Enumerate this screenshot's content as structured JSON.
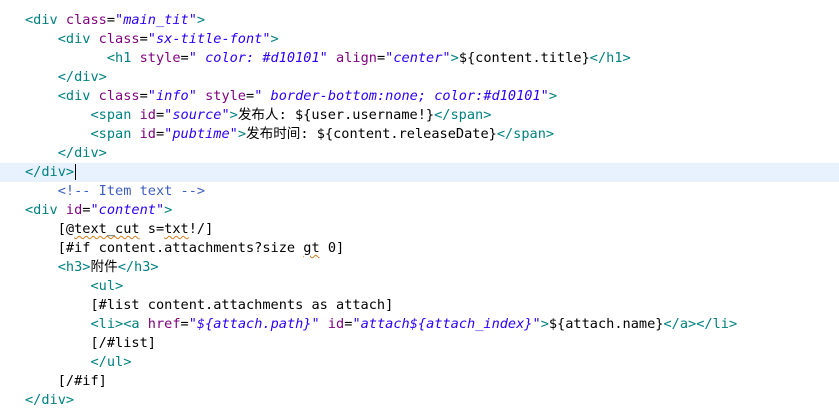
{
  "editor": {
    "lines": [
      [
        {
          "t": "<div ",
          "c": "tg"
        },
        {
          "t": "class",
          "c": "an"
        },
        {
          "t": "=",
          "c": "tx"
        },
        {
          "t": "\"main_tit\"",
          "c": "av"
        },
        {
          "t": ">",
          "c": "tg"
        }
      ],
      [
        {
          "t": "    "
        },
        {
          "t": "<div ",
          "c": "tg"
        },
        {
          "t": "class",
          "c": "an"
        },
        {
          "t": "=",
          "c": "tx"
        },
        {
          "t": "\"sx-title-font\"",
          "c": "av"
        },
        {
          "t": ">",
          "c": "tg"
        }
      ],
      [
        {
          "t": "          "
        },
        {
          "t": "<h1 ",
          "c": "tg"
        },
        {
          "t": "style",
          "c": "an"
        },
        {
          "t": "=",
          "c": "tx"
        },
        {
          "t": "\" color: #d10101\"",
          "c": "av"
        },
        {
          "t": " align",
          "c": "an"
        },
        {
          "t": "=",
          "c": "tx"
        },
        {
          "t": "\"center\"",
          "c": "av"
        },
        {
          "t": ">",
          "c": "tg"
        },
        {
          "t": "${content.title}",
          "c": "tx"
        },
        {
          "t": "</h1>",
          "c": "tg"
        }
      ],
      [
        {
          "t": "    "
        },
        {
          "t": "</div>",
          "c": "tg"
        }
      ],
      [
        {
          "t": "    "
        },
        {
          "t": "<div ",
          "c": "tg"
        },
        {
          "t": "class",
          "c": "an"
        },
        {
          "t": "=",
          "c": "tx"
        },
        {
          "t": "\"info\"",
          "c": "av"
        },
        {
          "t": " style",
          "c": "an"
        },
        {
          "t": "=",
          "c": "tx"
        },
        {
          "t": "\" border-bottom:none; color:#d10101\"",
          "c": "av"
        },
        {
          "t": ">",
          "c": "tg"
        }
      ],
      [
        {
          "t": "        "
        },
        {
          "t": "<span ",
          "c": "tg"
        },
        {
          "t": "id",
          "c": "an"
        },
        {
          "t": "=",
          "c": "tx"
        },
        {
          "t": "\"source\"",
          "c": "av"
        },
        {
          "t": ">",
          "c": "tg"
        },
        {
          "t": "发布人: ${user.username!}",
          "c": "tx"
        },
        {
          "t": "</span>",
          "c": "tg"
        }
      ],
      [
        {
          "t": "        "
        },
        {
          "t": "<span ",
          "c": "tg"
        },
        {
          "t": "id",
          "c": "an"
        },
        {
          "t": "=",
          "c": "tx"
        },
        {
          "t": "\"pubtime\"",
          "c": "av"
        },
        {
          "t": ">",
          "c": "tg"
        },
        {
          "t": "发布时间: ${content.releaseDate}",
          "c": "tx"
        },
        {
          "t": "</span>",
          "c": "tg"
        }
      ],
      [
        {
          "t": "    "
        },
        {
          "t": "</div>",
          "c": "tg"
        }
      ],
      [
        {
          "t": "</div>",
          "c": "tg"
        }
      ],
      [
        {
          "t": "    "
        },
        {
          "t": "<!-- Item text -->",
          "c": "cm"
        }
      ],
      [
        {
          "t": "<div ",
          "c": "tg"
        },
        {
          "t": "id",
          "c": "an"
        },
        {
          "t": "=",
          "c": "tx"
        },
        {
          "t": "\"content\"",
          "c": "av"
        },
        {
          "t": ">",
          "c": "tg"
        }
      ],
      [
        {
          "t": "    "
        },
        {
          "t": "[@",
          "c": "tx"
        },
        {
          "t": "text_cut",
          "c": "sq"
        },
        {
          "t": " s=",
          "c": "tx"
        },
        {
          "t": "txt",
          "c": "sq"
        },
        {
          "t": "!/]",
          "c": "tx"
        }
      ],
      [
        {
          "t": "    "
        },
        {
          "t": "[#if content.attachments?size ",
          "c": "tx"
        },
        {
          "t": "gt",
          "c": "sq"
        },
        {
          "t": " 0]",
          "c": "tx"
        }
      ],
      [
        {
          "t": "    "
        },
        {
          "t": "<h3>",
          "c": "tg"
        },
        {
          "t": "附件",
          "c": "tx"
        },
        {
          "t": "</h3>",
          "c": "tg"
        }
      ],
      [
        {
          "t": "        "
        },
        {
          "t": "<ul>",
          "c": "tg"
        }
      ],
      [
        {
          "t": "        "
        },
        {
          "t": "[#list content.attachments as attach]",
          "c": "tx"
        }
      ],
      [
        {
          "t": "        "
        },
        {
          "t": "<li>",
          "c": "tg"
        },
        {
          "t": "<a ",
          "c": "tg"
        },
        {
          "t": "href",
          "c": "an"
        },
        {
          "t": "=",
          "c": "tx"
        },
        {
          "t": "\"${attach.path}\"",
          "c": "av"
        },
        {
          "t": " id",
          "c": "an"
        },
        {
          "t": "=",
          "c": "tx"
        },
        {
          "t": "\"attach${attach_index}\"",
          "c": "av"
        },
        {
          "t": ">",
          "c": "tg"
        },
        {
          "t": "${attach.name}",
          "c": "tx"
        },
        {
          "t": "</a>",
          "c": "tg"
        },
        {
          "t": "</li>",
          "c": "tg"
        }
      ],
      [
        {
          "t": "        "
        },
        {
          "t": "[/#list]",
          "c": "tx"
        }
      ],
      [
        {
          "t": "        "
        },
        {
          "t": "</ul>",
          "c": "tg"
        }
      ],
      [
        {
          "t": "    "
        },
        {
          "t": "[/#if]",
          "c": "tx"
        }
      ],
      [
        {
          "t": "</div>",
          "c": "tg"
        }
      ]
    ],
    "current_line": 9,
    "colors": {
      "tag": "#008080",
      "attribute_name": "#7f007f",
      "attribute_value": "#2a00ff",
      "comment": "#3f5fbf",
      "text": "#000000",
      "current_line_bg": "#e8f2fe",
      "spell_warning": "#d08020"
    }
  }
}
